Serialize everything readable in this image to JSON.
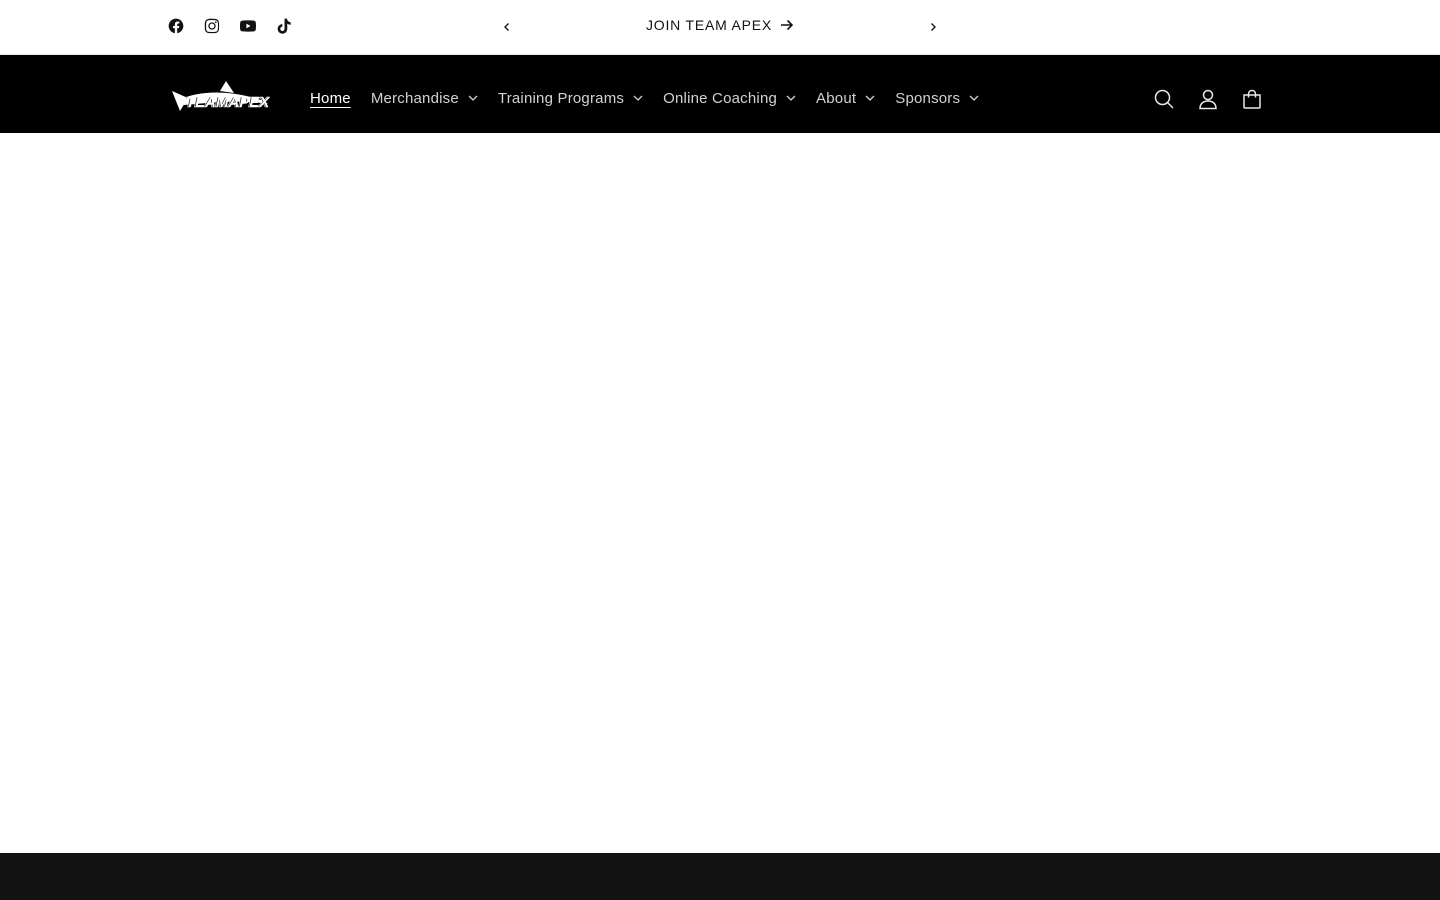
{
  "social": [
    {
      "name": "Facebook",
      "icon": "facebook-icon"
    },
    {
      "name": "Instagram",
      "icon": "instagram-icon"
    },
    {
      "name": "YouTube",
      "icon": "youtube-icon"
    },
    {
      "name": "TikTok",
      "icon": "tiktok-icon"
    }
  ],
  "announcement": {
    "message": "JOIN TEAM APEX",
    "prev_icon": "chevron-left-icon",
    "next_icon": "chevron-right-icon",
    "arrow_icon": "arrow-right-icon"
  },
  "logo": {
    "text": "TEAMAPEX"
  },
  "nav": [
    {
      "label": "Home",
      "active": true,
      "dropdown": false
    },
    {
      "label": "Merchandise",
      "active": false,
      "dropdown": true
    },
    {
      "label": "Training Programs",
      "active": false,
      "dropdown": true
    },
    {
      "label": "Online Coaching",
      "active": false,
      "dropdown": true
    },
    {
      "label": "About",
      "active": false,
      "dropdown": true
    },
    {
      "label": "Sponsors",
      "active": false,
      "dropdown": true
    }
  ],
  "header_icons": [
    {
      "icon": "search-icon"
    },
    {
      "icon": "account-icon"
    },
    {
      "icon": "cart-icon"
    }
  ],
  "colors": {
    "header_bg": "#000000",
    "announcement_bg": "#ffffff",
    "footer_bg": "#121212",
    "nav_text": "#d2d2d2"
  }
}
